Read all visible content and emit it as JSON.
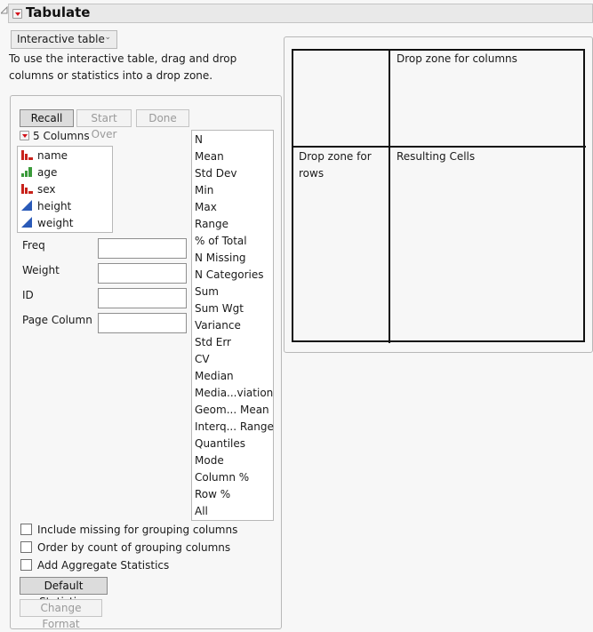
{
  "header": {
    "title": "Tabulate",
    "disclosure_icon": "outline-disclosure-icon",
    "menu_icon": "red-triangle-menu-icon"
  },
  "mode_select": {
    "value": "Interactive table"
  },
  "instructions": [
    "To use the interactive table, drag and drop",
    "columns or statistics into a drop zone."
  ],
  "buttons": {
    "recall": "Recall",
    "start_over": "Start Over",
    "done": "Done",
    "default_statistics": "Default Statistics",
    "change_format": "Change Format"
  },
  "columns_header": {
    "label": "5 Columns",
    "menu_icon": "red-triangle-menu-icon"
  },
  "columns": [
    {
      "name": "name",
      "type": "nominal",
      "icon": "nominal-bar-icon",
      "color": "#c8221b"
    },
    {
      "name": "age",
      "type": "ordinal",
      "icon": "ordinal-bar-icon",
      "color": "#3a9a3a"
    },
    {
      "name": "sex",
      "type": "nominal",
      "icon": "nominal-bar-icon",
      "color": "#c8221b"
    },
    {
      "name": "height",
      "type": "continuous",
      "icon": "continuous-triangle-icon",
      "color": "#2a5ab8"
    },
    {
      "name": "weight",
      "type": "continuous",
      "icon": "continuous-triangle-icon",
      "color": "#2a5ab8"
    }
  ],
  "roles": [
    {
      "label": "Freq",
      "value": ""
    },
    {
      "label": "Weight",
      "value": ""
    },
    {
      "label": "ID",
      "value": ""
    },
    {
      "label": "Page Column",
      "value": ""
    }
  ],
  "statistics": [
    "N",
    "Mean",
    "Std Dev",
    "Min",
    "Max",
    "Range",
    "% of Total",
    "N Missing",
    "N Categories",
    "Sum",
    "Sum Wgt",
    "Variance",
    "Std Err",
    "CV",
    "Median",
    "Media...viation",
    "Geom... Mean",
    "Interq... Range",
    "Quantiles",
    "Mode",
    "Column %",
    "Row %",
    "All"
  ],
  "options": [
    {
      "label": "Include missing for grouping columns",
      "checked": false
    },
    {
      "label": "Order by count of grouping columns",
      "checked": false
    },
    {
      "label": "Add Aggregate Statistics",
      "checked": false
    }
  ],
  "table_layout": {
    "columns_zone": "Drop zone for columns",
    "rows_zone_line1": "Drop zone for",
    "rows_zone_line2": "rows",
    "cells_zone": "Resulting Cells"
  }
}
